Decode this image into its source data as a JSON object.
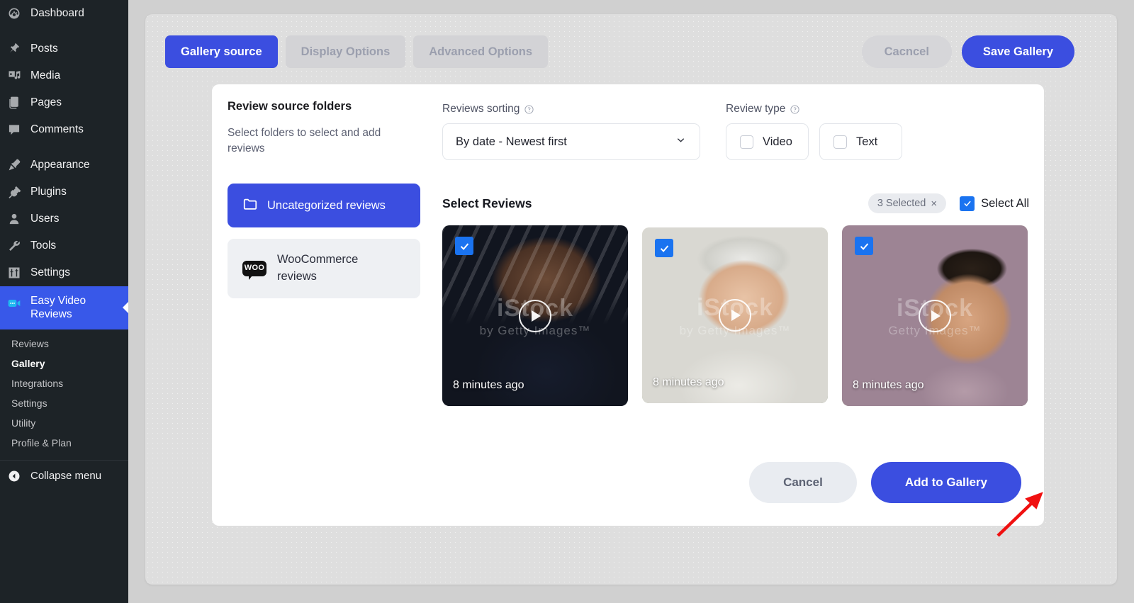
{
  "sidebar": {
    "items": [
      {
        "label": "Dashboard",
        "icon": "dashboard-icon",
        "name": "dashboard"
      },
      {
        "label": "Posts",
        "icon": "pin-icon",
        "name": "posts"
      },
      {
        "label": "Media",
        "icon": "media-icon",
        "name": "media"
      },
      {
        "label": "Pages",
        "icon": "pages-icon",
        "name": "pages"
      },
      {
        "label": "Comments",
        "icon": "comment-icon",
        "name": "comments"
      },
      {
        "label": "Appearance",
        "icon": "brush-icon",
        "name": "appearance"
      },
      {
        "label": "Plugins",
        "icon": "plug-icon",
        "name": "plugins"
      },
      {
        "label": "Users",
        "icon": "user-icon",
        "name": "users"
      },
      {
        "label": "Tools",
        "icon": "wrench-icon",
        "name": "tools"
      },
      {
        "label": "Settings",
        "icon": "sliders-icon",
        "name": "settings"
      }
    ],
    "current": {
      "label_line1": "Easy Video",
      "label_line2": "Reviews",
      "icon": "video-camera-icon"
    },
    "submenu": [
      {
        "label": "Reviews",
        "active": false
      },
      {
        "label": "Gallery",
        "active": true
      },
      {
        "label": "Integrations",
        "active": false
      },
      {
        "label": "Settings",
        "active": false
      },
      {
        "label": "Utility",
        "active": false
      },
      {
        "label": "Profile & Plan",
        "active": false
      }
    ],
    "collapse": {
      "label": "Collapse menu",
      "icon": "chevron-left-circle-icon"
    }
  },
  "topbar": {
    "tabs": [
      {
        "label": "Gallery source",
        "active": true
      },
      {
        "label": "Display Options",
        "active": false
      },
      {
        "label": "Advanced Options",
        "active": false
      }
    ],
    "cancel_label": "Cacncel",
    "save_label": "Save Gallery"
  },
  "left_panel": {
    "title": "Review source folders",
    "description": "Select folders to select and add reviews",
    "folders": [
      {
        "label": "Uncategorized reviews",
        "icon": "folder-icon",
        "selected": true
      },
      {
        "label": "WooCommerce reviews",
        "icon": "woocommerce-icon",
        "selected": false
      }
    ],
    "woo_icon_text": "WOO"
  },
  "filters": {
    "sorting_label": "Reviews sorting",
    "sorting_value": "By date - Newest first",
    "sorting_options": [
      "By date - Newest first"
    ],
    "review_type_label": "Review type",
    "types": [
      {
        "label": "Video",
        "checked": false
      },
      {
        "label": "Text",
        "checked": false
      }
    ]
  },
  "reviews_section": {
    "title": "Select Reviews",
    "selected_badge": "3 Selected",
    "badge_clear": "×",
    "select_all_label": "Select All",
    "select_all_checked": true,
    "cards": [
      {
        "time": "8 minutes ago",
        "checked": true,
        "watermark_top": "iStock",
        "watermark_bottom": "by Getty Images™"
      },
      {
        "time": "8 minutes ago",
        "checked": true,
        "watermark_top": "iStock",
        "watermark_bottom": "by Getty Images™"
      },
      {
        "time": "8 minutes ago",
        "checked": true,
        "watermark_top": "iStock",
        "watermark_bottom": "Getty Images™"
      }
    ]
  },
  "card_actions": {
    "cancel_label": "Cancel",
    "add_label": "Add to Gallery"
  },
  "colors": {
    "accent_blue": "#3b4ee0",
    "checkbox_blue": "#1a73f0",
    "sidebar_bg": "#1d2327",
    "sidebar_active": "#3858e9",
    "arrow_red": "#f01010",
    "panel_bg": "#dedede"
  }
}
